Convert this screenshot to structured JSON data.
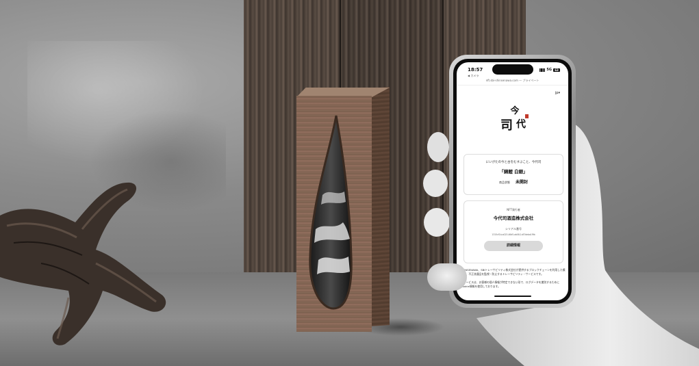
{
  "phone": {
    "status_time": "18:57",
    "status_sub": "◀ カメラ",
    "network": "5G",
    "battery": "63",
    "url": "nft.sbi-shinsenawa.com — プライベート",
    "language": "jp",
    "brand_logo_text": "今代司",
    "card1": {
      "subtitle": "にいがたの今と古をむすぶこと、今代司",
      "title": "「錦鯉 白銀」",
      "status_label": "商品状態",
      "status_value": "未開封"
    },
    "card2": {
      "label": "NFT発行者",
      "issuer": "今代司酒造株式会社",
      "serial_label": "シリアル番号",
      "serial": "1315cf1b-a023-46d5-ab08-1c87deba1f9b",
      "detail_button": "詳細情報"
    },
    "footer": {
      "paragraph1": "SHINSENAWA、SBIトレーサビリティ株式会社が提供するブロックチェーンを利用した模倣品、不正流通品を監視・防止するトレーサビリティ・サービスです。",
      "paragraph2": "本サービスは、お客様の個人情報が特定できない形で、ログデータを識別するためにCookie情報を使用しております。"
    }
  }
}
